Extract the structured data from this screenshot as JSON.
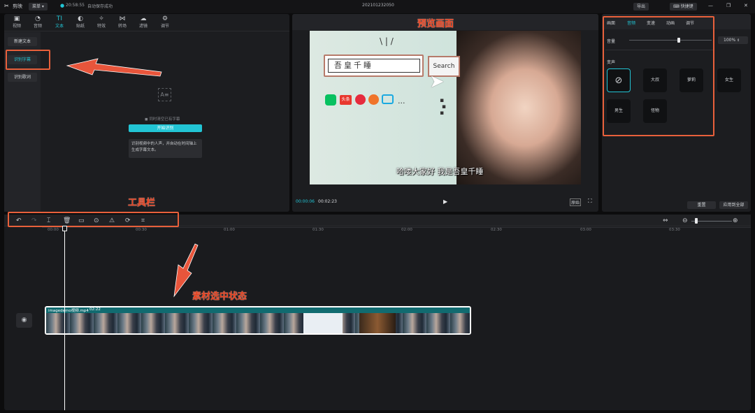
{
  "titlebar": {
    "app_name": "剪映",
    "menu_label": "菜单",
    "save_time": "20:58:55",
    "save_status": "自动保存成功",
    "project_name": "202101232050",
    "export_label": "导出",
    "shortcut_label": "快捷键"
  },
  "tools": [
    {
      "icon": "video-icon",
      "label": "视频"
    },
    {
      "icon": "audio-icon",
      "label": "音频"
    },
    {
      "icon": "text-icon",
      "label": "文本"
    },
    {
      "icon": "sticker-icon",
      "label": "贴纸"
    },
    {
      "icon": "effects-icon",
      "label": "特效"
    },
    {
      "icon": "transition-icon",
      "label": "转场"
    },
    {
      "icon": "filter-icon",
      "label": "滤镜"
    },
    {
      "icon": "adjust-icon",
      "label": "调节"
    }
  ],
  "text_side": [
    "新建文本",
    "识别字幕",
    "识别歌词"
  ],
  "recognize": {
    "checkbox_label": "同时清空已有字幕",
    "start_button": "开始识别",
    "tooltip": "识别视频中的人声，并自动在时间轴上生成字幕文本。"
  },
  "preview": {
    "search_box_text": "吾皇千睡",
    "search_button": "Search",
    "caption": "哈喽大家好 我是吾皇千睡",
    "dots": "...",
    "current_time": "00:00:06",
    "total_time": "00:02:23",
    "ratio_label": "原始",
    "toutiao_label": "头条"
  },
  "properties": {
    "tabs": [
      "画面",
      "音频",
      "变速",
      "动画",
      "调节"
    ],
    "active_tab": "音频",
    "volume_label": "音量",
    "volume_value": "100%",
    "volume_level": 0.6,
    "voice_label": "变声",
    "voices": [
      "大叔",
      "萝莉",
      "女生",
      "男生",
      "怪物"
    ],
    "reset_button": "重置",
    "apply_all_button": "应用到全部"
  },
  "timeline": {
    "ticks": [
      "00:00",
      "00:30",
      "01:00",
      "01:30",
      "02:00",
      "02:30",
      "03:00",
      "03:30"
    ],
    "clip_name": "imagedemo视频.mp4",
    "clip_duration": "02:22"
  },
  "annotations": {
    "preview": "预览画面",
    "toolbar": "工具栏",
    "selected": "素材选中状态"
  },
  "colors": {
    "accent": "#22c5d5",
    "annotation": "#e8401d",
    "clip_border": "#ffffff"
  }
}
